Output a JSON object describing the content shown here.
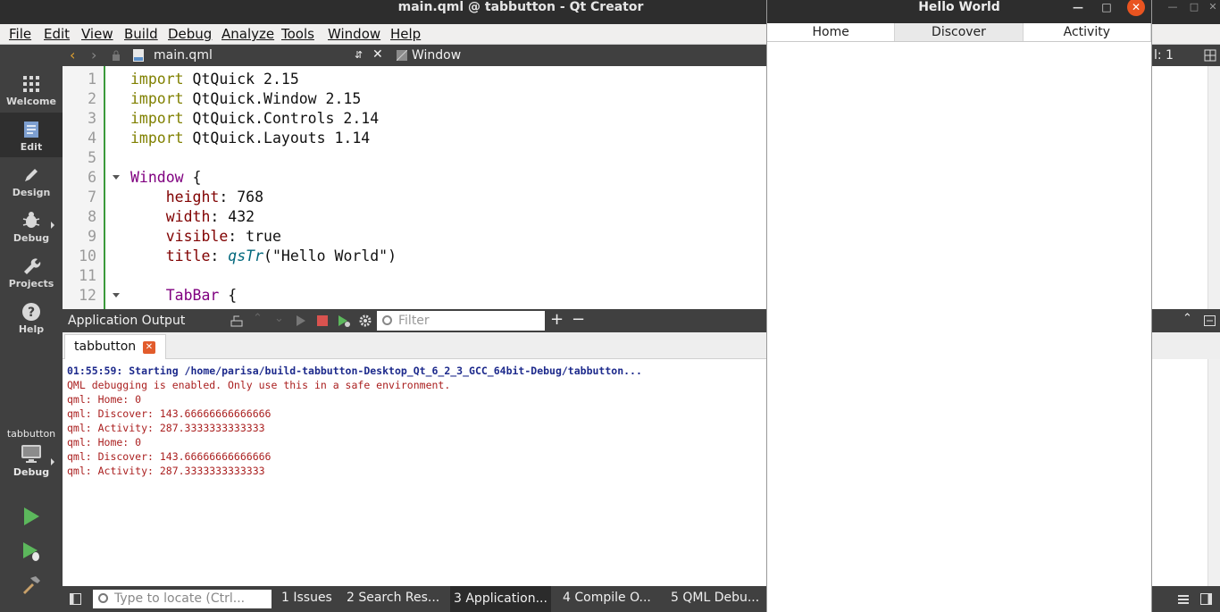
{
  "window_title": "main.qml @ tabbutton - Qt Creator",
  "menubar": [
    "File",
    "Edit",
    "View",
    "Build",
    "Debug",
    "Analyze",
    "Tools",
    "Window",
    "Help"
  ],
  "modes": [
    {
      "label": "Welcome",
      "icon": "grid-icon"
    },
    {
      "label": "Edit",
      "icon": "edit-document-icon"
    },
    {
      "label": "Design",
      "icon": "pen-icon"
    },
    {
      "label": "Debug",
      "icon": "bug-icon"
    },
    {
      "label": "Projects",
      "icon": "wrench-icon"
    },
    {
      "label": "Help",
      "icon": "help-icon"
    }
  ],
  "kit": {
    "project": "tabbutton",
    "config": "Debug"
  },
  "editor_toolbar": {
    "file": "main.qml",
    "symbol": "Window",
    "col_indicator": "l: 1"
  },
  "code_lines": [
    {
      "n": "1",
      "tokens": [
        [
          "kw",
          "import"
        ],
        [
          "",
          "QtQuick 2.15"
        ]
      ]
    },
    {
      "n": "2",
      "tokens": [
        [
          "kw",
          "import"
        ],
        [
          "",
          "QtQuick.Window 2.15"
        ]
      ]
    },
    {
      "n": "3",
      "tokens": [
        [
          "kw",
          "import"
        ],
        [
          "",
          "QtQuick.Controls 2.14"
        ]
      ]
    },
    {
      "n": "4",
      "tokens": [
        [
          "kw",
          "import"
        ],
        [
          "",
          "QtQuick.Layouts 1.14"
        ]
      ]
    },
    {
      "n": "5",
      "tokens": []
    },
    {
      "n": "6",
      "tokens": [
        [
          "ty",
          "Window"
        ],
        [
          "",
          " {"
        ]
      ]
    },
    {
      "n": "7",
      "tokens": [
        [
          "",
          "    "
        ],
        [
          "pr",
          "height"
        ],
        [
          "",
          ": 768"
        ]
      ]
    },
    {
      "n": "8",
      "tokens": [
        [
          "",
          "    "
        ],
        [
          "pr",
          "width"
        ],
        [
          "",
          ": 432"
        ]
      ]
    },
    {
      "n": "9",
      "tokens": [
        [
          "",
          "    "
        ],
        [
          "pr",
          "visible"
        ],
        [
          "",
          ": true"
        ]
      ]
    },
    {
      "n": "10",
      "tokens": [
        [
          "",
          "    "
        ],
        [
          "pr",
          "title"
        ],
        [
          "",
          ": "
        ],
        [
          "fn",
          "qsTr"
        ],
        [
          "",
          "(\"Hello World\")"
        ]
      ]
    },
    {
      "n": "11",
      "tokens": []
    },
    {
      "n": "12",
      "tokens": [
        [
          "",
          "    "
        ],
        [
          "ty",
          "TabBar"
        ],
        [
          "",
          " {"
        ]
      ]
    }
  ],
  "output_pane": {
    "title": "Application Output",
    "filter_placeholder": "Filter",
    "tab": "tabbutton",
    "lines": [
      {
        "kind": "start",
        "text": "01:55:59: Starting /home/parisa/build-tabbutton-Desktop_Qt_6_2_3_GCC_64bit-Debug/tabbutton..."
      },
      {
        "kind": "msg",
        "text": "QML debugging is enabled. Only use this in a safe environment."
      },
      {
        "kind": "msg",
        "text": "qml: Home: 0"
      },
      {
        "kind": "msg",
        "text": "qml: Discover: 143.66666666666666"
      },
      {
        "kind": "msg",
        "text": "qml: Activity: 287.3333333333333"
      },
      {
        "kind": "msg",
        "text": "qml: Home: 0"
      },
      {
        "kind": "msg",
        "text": "qml: Discover: 143.66666666666666"
      },
      {
        "kind": "msg",
        "text": "qml: Activity: 287.3333333333333"
      }
    ]
  },
  "statusbar": {
    "locate_placeholder": "Type to locate (Ctrl...",
    "panes": [
      "1  Issues",
      "2  Search Res...",
      "3  Application...",
      "4  Compile O...",
      "5  QML Debu..."
    ]
  },
  "hello_window": {
    "title": "Hello World",
    "tabs": [
      "Home",
      "Discover",
      "Activity"
    ],
    "selected_tab": "Discover"
  },
  "colors": {
    "accent_close": "#e95420",
    "gutter_bar": "#3b9a3b"
  }
}
